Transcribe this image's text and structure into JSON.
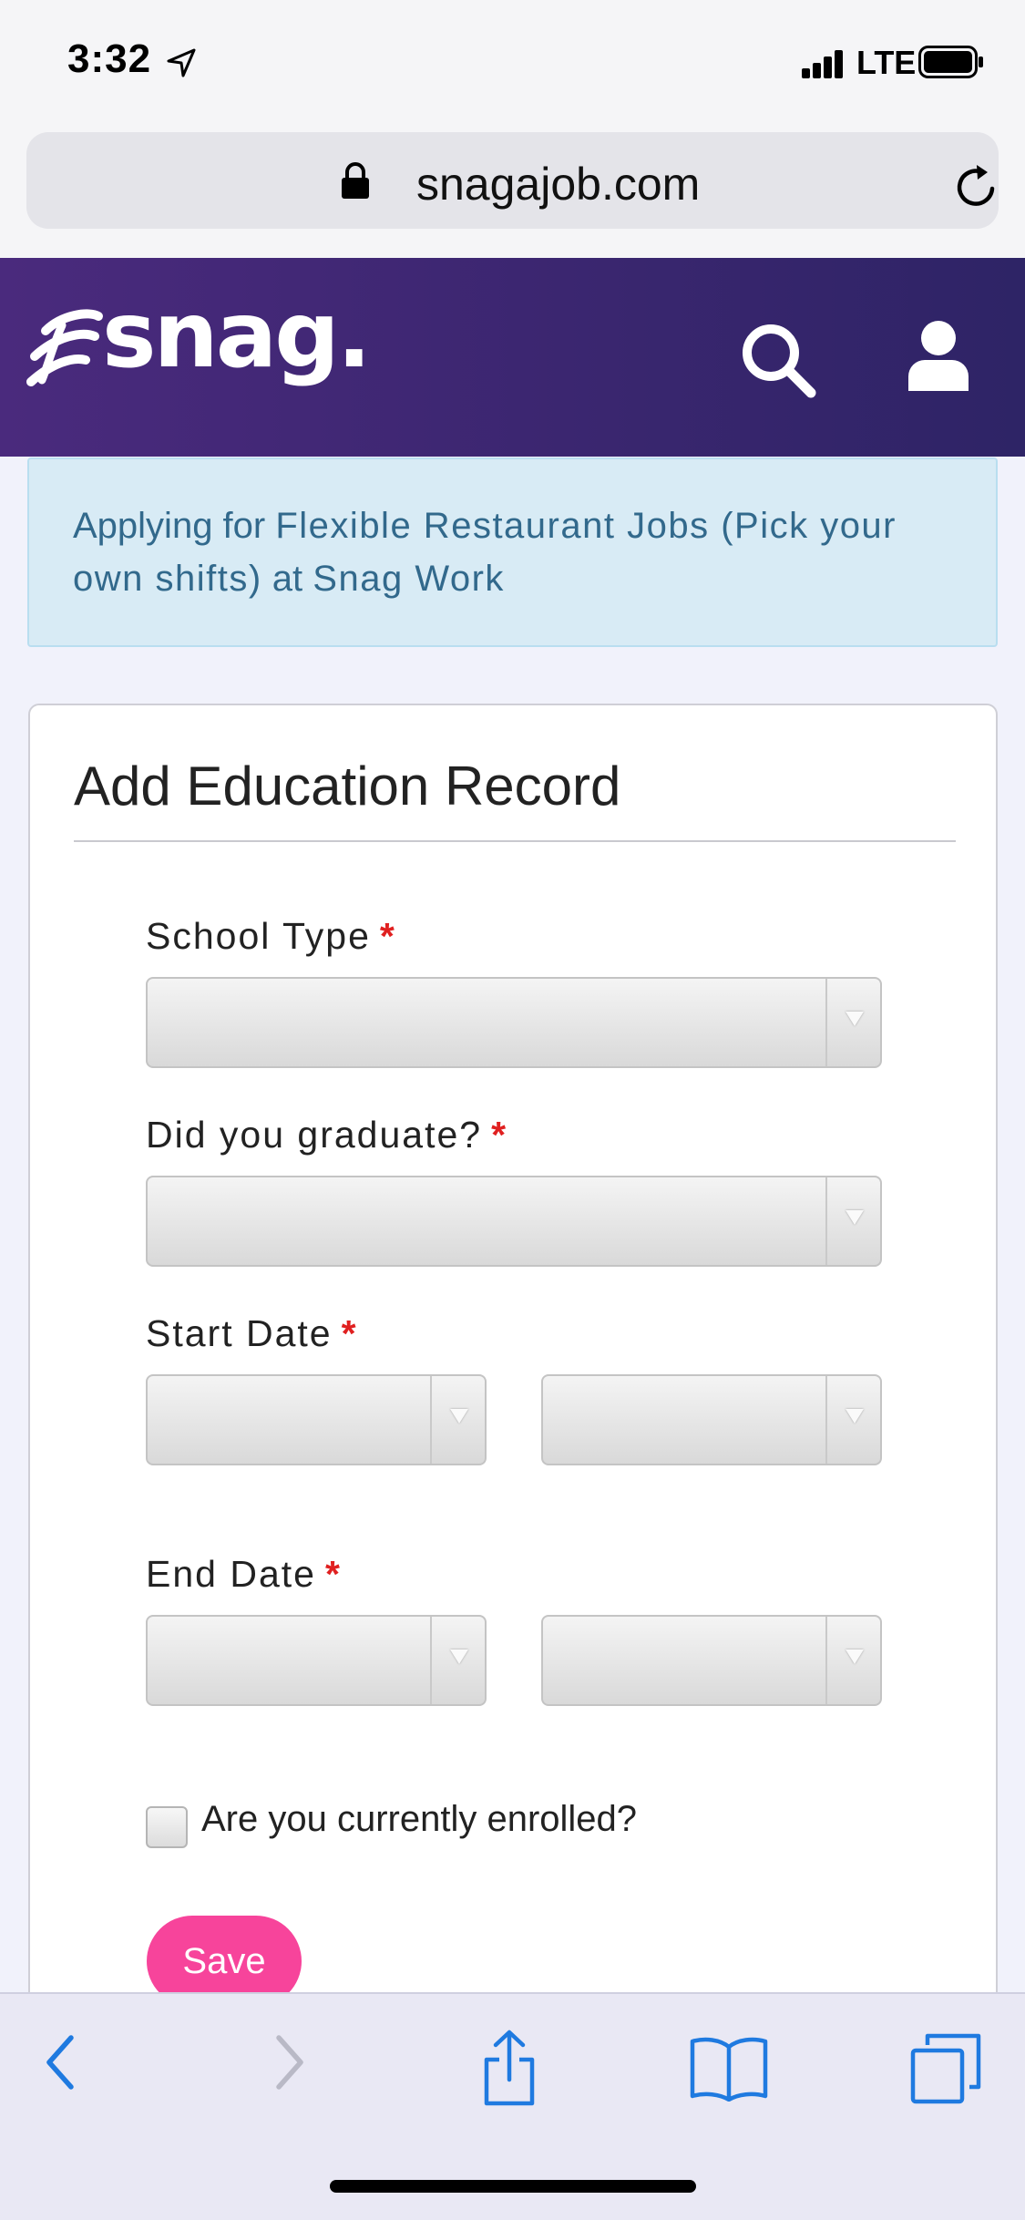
{
  "status_bar": {
    "time": "3:32",
    "network": "LTE"
  },
  "browser": {
    "url": "snagajob.com"
  },
  "header": {
    "logo_text": "snag.",
    "brand_colors": {
      "header_start": "#4a2a7d",
      "header_end": "#2e2466",
      "accent": "#f7449b"
    }
  },
  "banner": {
    "prefix": "Applying for",
    "job_title": "Flexible Restaurant Jobs (Pick your own shifts)",
    "connector": "at",
    "company": "Snag Work"
  },
  "form": {
    "title": "Add Education Record",
    "school_type_label": "School Type",
    "graduated_label": "Did you graduate?",
    "start_date_label": "Start Date",
    "end_date_label": "End Date",
    "required_marker": "*",
    "enrolled_label": "Are you currently enrolled?",
    "save_label": "Save"
  },
  "toolbar": {
    "icons": [
      "back-icon",
      "forward-icon",
      "share-icon",
      "bookmarks-icon",
      "tabs-icon"
    ]
  }
}
